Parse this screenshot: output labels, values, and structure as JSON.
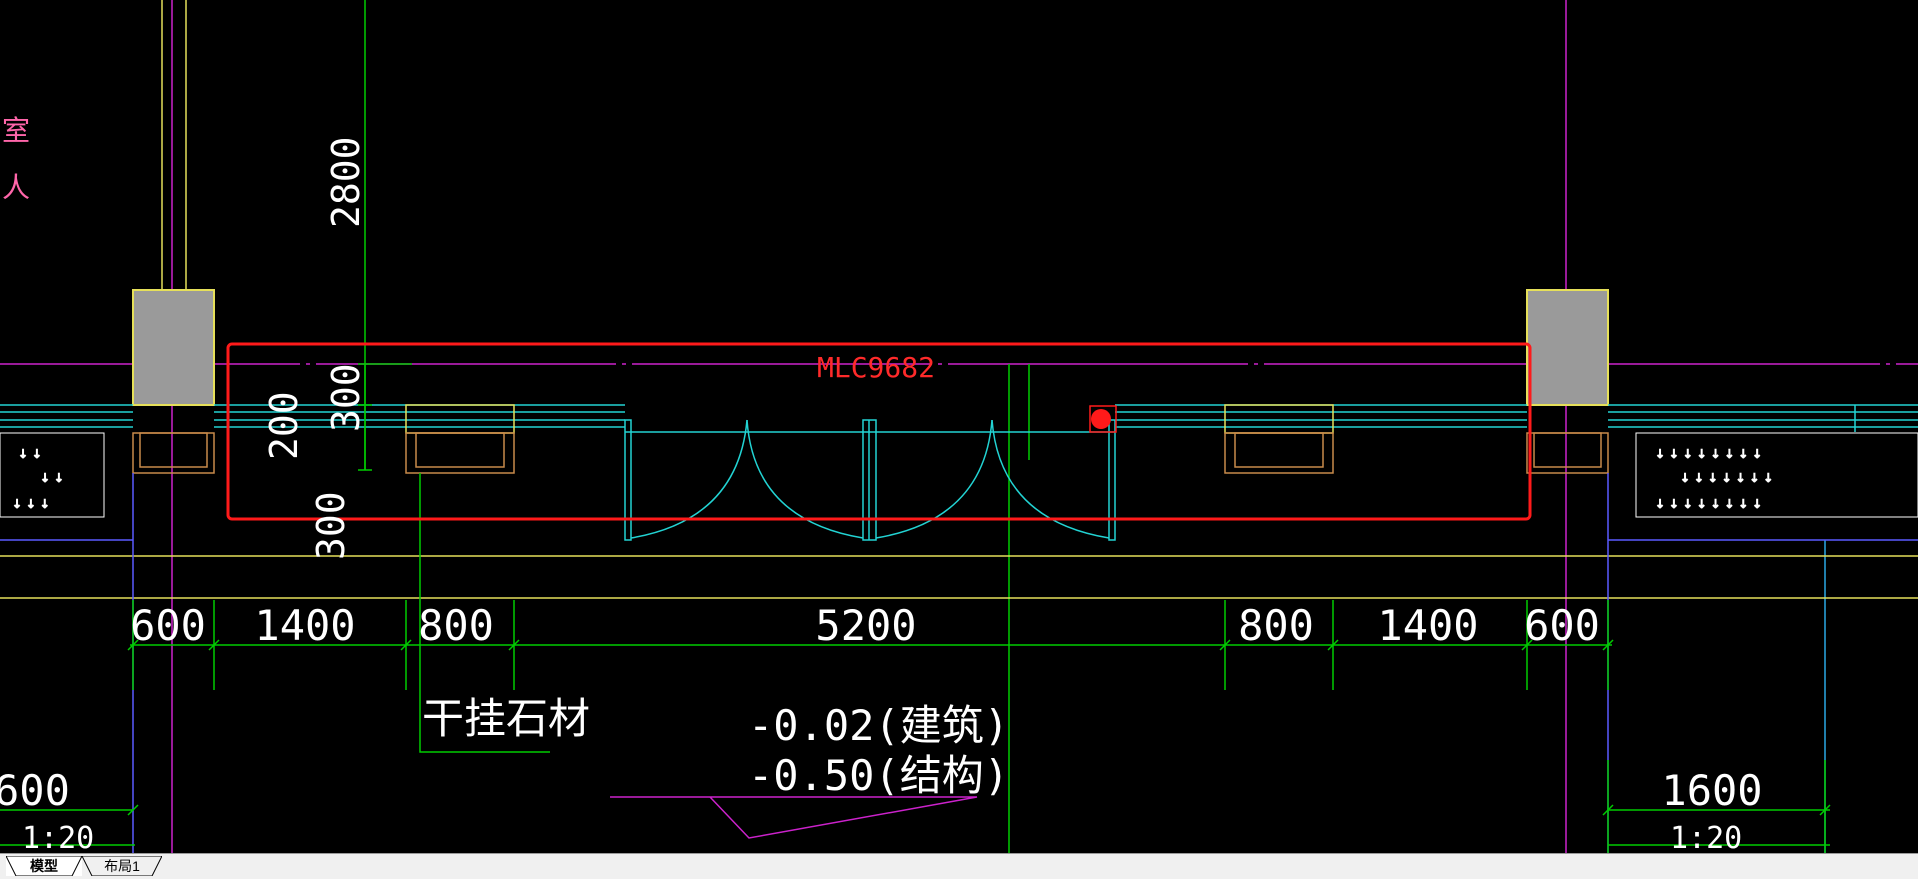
{
  "drawing": {
    "block_label": "MLC9682",
    "left_room_labels": [
      "室",
      "人"
    ],
    "dimensions": {
      "top_vertical": "2800",
      "left_300_upper": "300",
      "left_200": "200",
      "left_300_lower": "300",
      "bottom": [
        "600",
        "1400",
        "800",
        "5200",
        "800",
        "1400",
        "600"
      ],
      "left_edge": "600",
      "right_lower": "1600"
    },
    "scales": [
      "1:20",
      "1:20"
    ],
    "material_note": "干挂石材",
    "elevation_architectural": "-0.02(建筑)",
    "elevation_structural": "-0.50(结构)"
  },
  "colors": {
    "background": "#000000",
    "selection": "#ff1a1a",
    "wall_yellow": "#e6e05a",
    "dimension_green": "#00cc00",
    "glazing_cyan": "#22d3d3",
    "axis_magenta": "#cc22cc",
    "column_fill": "#9a9a9a",
    "text_white": "#ffffff",
    "pink_text": "#ff66aa"
  },
  "tabs": [
    {
      "label": "模型",
      "active": true
    },
    {
      "label": "布局1",
      "active": false
    }
  ]
}
